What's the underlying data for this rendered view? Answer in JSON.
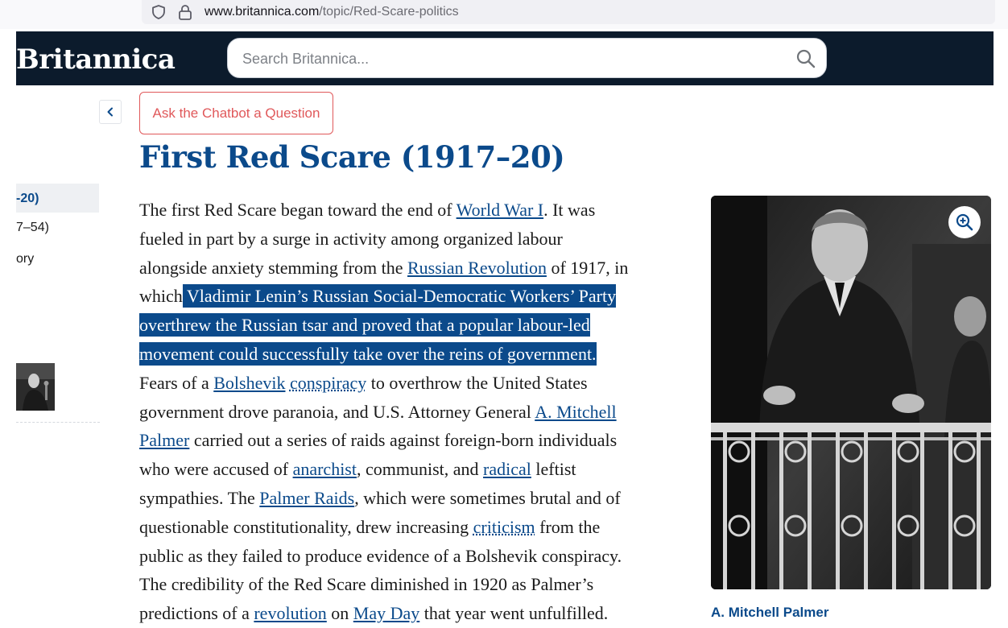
{
  "browser": {
    "url_domain": "www.britannica.com",
    "url_path": "/topic/Red-Scare-politics",
    "icons": [
      "shield-icon",
      "lock-icon"
    ]
  },
  "header": {
    "logo": "Britannica",
    "search": {
      "placeholder": "Search Britannica...",
      "value": "",
      "icon": "search-icon"
    },
    "background_color": "#0c1b2c"
  },
  "sidebar": {
    "collapse_icon": "chevron-left-icon",
    "items": [
      {
        "label": "-20)",
        "active": true
      },
      {
        "label": "7–54)",
        "active": false
      },
      {
        "label": "ory",
        "active": false
      }
    ]
  },
  "chatbot_button": {
    "label": "Ask the Chatbot a Question",
    "color": "#e0585a"
  },
  "article": {
    "title": "First Red Scare (1917–20)",
    "lines": [
      {
        "a": "The first Red Scare began toward the end of ",
        "link": "World War I",
        "b": ". It was"
      },
      {
        "a": "fueled in part by a surge in activity among organized labour"
      },
      {
        "a": "alongside anxiety stemming from the ",
        "link": "Russian Revolution",
        "b": " of 1917, in"
      },
      {
        "a": "which",
        "hl": " Vladimir Lenin’s Russian Social-Democratic Workers’ Party"
      },
      {
        "hl": "overthrew the Russian tsar and proved that a popular labour-led"
      },
      {
        "hl": "movement could successfully take over the reins of government. "
      },
      {
        "a": "Fears of a ",
        "link": "Bolshevik",
        "b": " ",
        "link2": "conspiracy",
        "c": " to overthrow the United States"
      },
      {
        "a": "government drove paranoia, and U.S. Attorney General ",
        "link": "A. Mitchell"
      },
      {
        "link0": "Palmer",
        "a": " carried out a series of raids against foreign-born individuals"
      },
      {
        "a": "who were accused of ",
        "link": "anarchist",
        "b": ", communist, and ",
        "link2": "radical",
        "c": " leftist"
      },
      {
        "a": "sympathies. The ",
        "link": "Palmer Raids",
        "b": ", which were sometimes brutal and of"
      },
      {
        "a": "questionable constitutionality, drew increasing ",
        "link": "criticism",
        "b": " from the"
      },
      {
        "a": "public as they failed to produce evidence of a Bolshevik conspiracy."
      },
      {
        "a": "The credibility of the Red Scare diminished in 1920 as Palmer’s"
      },
      {
        "a": "predictions of a ",
        "link": "revolution",
        "b": " on ",
        "link2": "May Day",
        "c": " that year went unfulfilled."
      }
    ],
    "highlight_color": "#0b4a8b",
    "link_color": "#0b4a8b"
  },
  "figure": {
    "caption": "A. Mitchell Palmer",
    "zoom_icon": "zoom-in-icon"
  }
}
